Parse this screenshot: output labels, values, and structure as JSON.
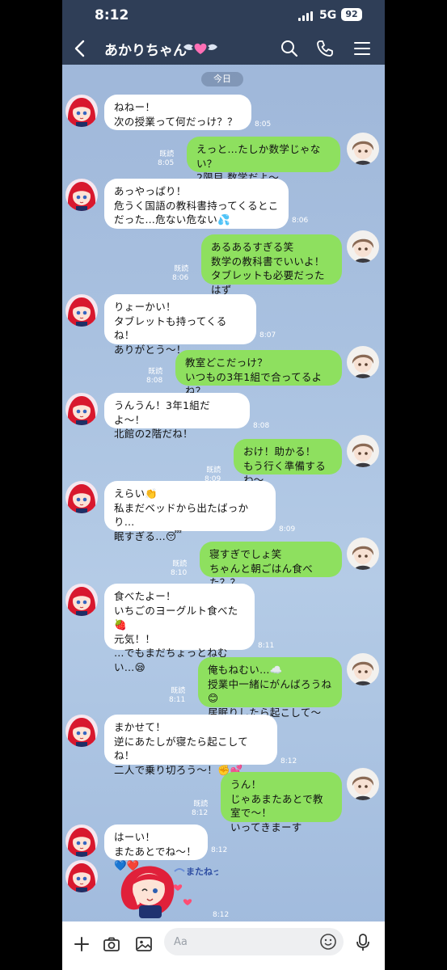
{
  "status_bar": {
    "time": "8:12",
    "network": "5G",
    "battery": "92"
  },
  "header": {
    "title": "あかりちゃん"
  },
  "date_chip": "今日",
  "messages": [
    {
      "side": "in",
      "text": "ねねー！\n次の授業って何だっけ？？",
      "time": "8:05"
    },
    {
      "side": "out",
      "text": "えっと…たしか数学じゃない？\n2限目 数学だよ〜",
      "read": "既読",
      "time": "8:05"
    },
    {
      "side": "in",
      "text": "あっやっぱり！\n危うく国語の教科書持ってくるとこ\nだった…危ない危ない💦",
      "time": "8:06"
    },
    {
      "side": "out",
      "text": "あるあるすぎる笑\n数学の教科書でいいよ！\nタブレットも必要だったはず",
      "read": "既読",
      "time": "8:06"
    },
    {
      "side": "in",
      "text": "りょーかい！\nタブレットも持ってくるね！\nありがとう〜！",
      "time": "8:07"
    },
    {
      "side": "out",
      "text": "教室どこだっけ？\nいつもの3年1組で合ってるよね？",
      "read": "既読",
      "time": "8:08"
    },
    {
      "side": "in",
      "text": "うんうん！3年1組だよ〜！\n北館の2階だね！",
      "time": "8:08"
    },
    {
      "side": "out",
      "text": "おけ！助かる！\nもう行く準備するわ〜",
      "read": "既読",
      "time": "8:09"
    },
    {
      "side": "in",
      "text": "えらい👏\n私まだベッドから出たばっかり…\n眠すぎる…😴",
      "time": "8:09"
    },
    {
      "side": "out",
      "text": "寝すぎでしょ笑\nちゃんと朝ごはん食べた？？",
      "read": "既読",
      "time": "8:10"
    },
    {
      "side": "in",
      "text": "食べたよー！\nいちごのヨーグルト食べた🍓\n元気！！\n…でもまだちょっとねむい…😪",
      "time": "8:11"
    },
    {
      "side": "out",
      "text": "俺もねむい…☁️\n授業中一緒にがんばろうね😊\n居眠りしたら起こして〜",
      "read": "既読",
      "time": "8:11"
    },
    {
      "side": "in",
      "text": "まかせて！\n逆にあたしが寝たら起こしてね！\n二人で乗り切ろう〜！✊💕",
      "time": "8:12"
    },
    {
      "side": "out",
      "text": "うん！\nじゃあまたあとで教室で〜！\nいってきまーす",
      "read": "既読",
      "time": "8:12"
    },
    {
      "side": "in",
      "text": "はーい！\nまたあとでね〜！💙❤️",
      "time": "8:12"
    },
    {
      "side": "in",
      "sticker": true,
      "sticker_text": "またねっ！",
      "time": "8:12"
    }
  ],
  "input_bar": {
    "placeholder": "Aa"
  },
  "icons": [
    "back-icon",
    "search-icon",
    "phone-icon",
    "menu-icon",
    "plus-icon",
    "camera-icon",
    "image-icon",
    "emoji-icon",
    "mic-icon"
  ],
  "colors": {
    "header": "#2f3e57",
    "out_bubble": "#8ee05f",
    "in_bubble": "#ffffff"
  }
}
